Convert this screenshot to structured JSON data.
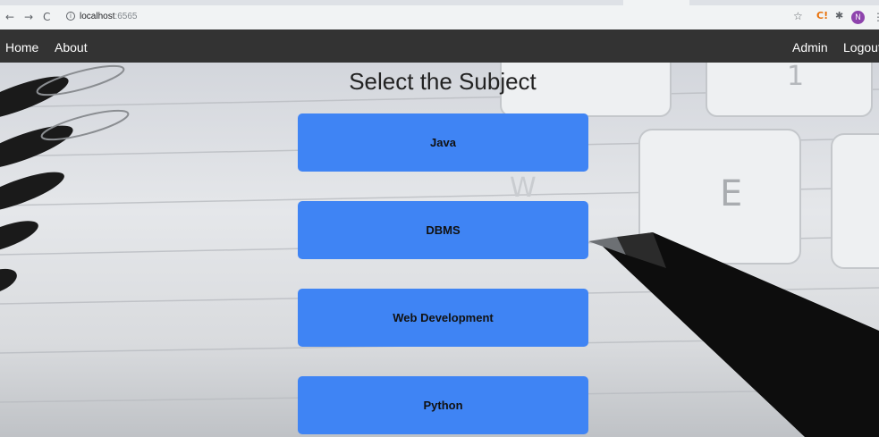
{
  "browser": {
    "back": "←",
    "forward": "→",
    "reload": "C",
    "url_host": "localhost",
    "url_port": ":6565",
    "info_icon": "i",
    "extension_label": "C!",
    "profile_initial": "N",
    "menu": "⋮"
  },
  "nav": {
    "home": "Home",
    "about": "About",
    "admin": "Admin",
    "logout": "Logout"
  },
  "main": {
    "title": "Select the Subject",
    "subjects": [
      "Java",
      "DBMS",
      "Web Development",
      "Python"
    ]
  },
  "colors": {
    "navbar": "#333333",
    "button": "#3f84f4"
  },
  "icons": {
    "star": "star-icon",
    "puzzle": "puzzle-icon"
  }
}
